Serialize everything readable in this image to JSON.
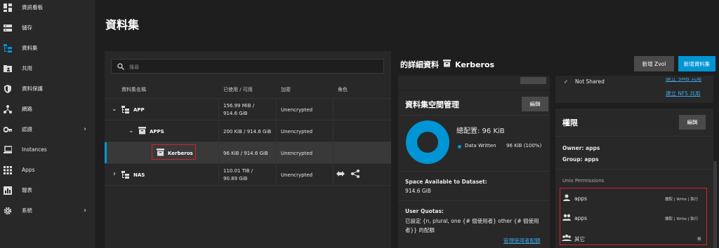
{
  "sidebar": {
    "items": [
      {
        "label": "資訊看板",
        "icon": "dashboard-icon"
      },
      {
        "label": "儲存",
        "icon": "storage-icon"
      },
      {
        "label": "資料集",
        "icon": "datasets-icon"
      },
      {
        "label": "共用",
        "icon": "shares-icon"
      },
      {
        "label": "資料保護",
        "icon": "shield-icon"
      },
      {
        "label": "網路",
        "icon": "network-icon"
      },
      {
        "label": "認證",
        "icon": "key-icon"
      },
      {
        "label": "Instances",
        "icon": "laptop-icon"
      },
      {
        "label": "Apps",
        "icon": "apps-grid-icon"
      },
      {
        "label": "報表",
        "icon": "reports-icon"
      },
      {
        "label": "系統",
        "icon": "gear-icon"
      }
    ]
  },
  "page": {
    "title": "資料集"
  },
  "search": {
    "placeholder": "搜尋"
  },
  "table": {
    "headers": {
      "name": "資料集名稱",
      "used": "已使用 / 可用",
      "encryption": "加密",
      "roles": "角色"
    },
    "rows": [
      {
        "name": "APP",
        "used1": "156.99 MiB /",
        "used2": "914.6 GiB",
        "enc": "Unencrypted"
      },
      {
        "name": "APPS",
        "used1": "200 KiB / 914.6 GiB",
        "enc": "Unencrypted"
      },
      {
        "name": "Kerberos",
        "used1": "96 KiB / 914.6 GiB",
        "enc": "Unencrypted"
      },
      {
        "name": "NAS",
        "used1": "110.01 TiB /",
        "used2": "90.89 GiB",
        "enc": "Unencrypted"
      }
    ]
  },
  "details": {
    "title_prefix": "的詳細資料",
    "dataset_name": "Kerberos",
    "add_zvol": "新增 Zvol",
    "add_dataset": "新增資料集"
  },
  "space_card": {
    "title": "資料集空間管理",
    "edit": "編輯",
    "total": "總配置: 96 KiB",
    "legend_label": "Data Written",
    "legend_value": "96 KiB (100%)",
    "avail_label": "Space Available to Dataset:",
    "avail_value": "914.6 GiB",
    "quota_label": "User Quotas:",
    "quota_text1": "已設定 {n, plural, one {# 個使用者} other {# 個使用",
    "quota_text2": "者}} 的配額",
    "manage_link": "管理使用者配額",
    "accent_color": "#0095d5"
  },
  "share_card": {
    "not_shared": "Not Shared",
    "link_smb": "建立 SMB 共用",
    "link_nfs": "建立 NFS 共用"
  },
  "perm_card": {
    "title": "權限",
    "edit": "編輯",
    "owner": "Owner: apps",
    "group": "Group: apps",
    "unix_label": "Unix Permissions",
    "rows": [
      {
        "name": "apps",
        "value": "讀取 | Write | 執行",
        "icon": "user-icon"
      },
      {
        "name": "apps",
        "value": "讀取 | Write | 執行",
        "icon": "group-icon"
      },
      {
        "name": "其它",
        "value": "無",
        "icon": "others-icon"
      }
    ]
  }
}
